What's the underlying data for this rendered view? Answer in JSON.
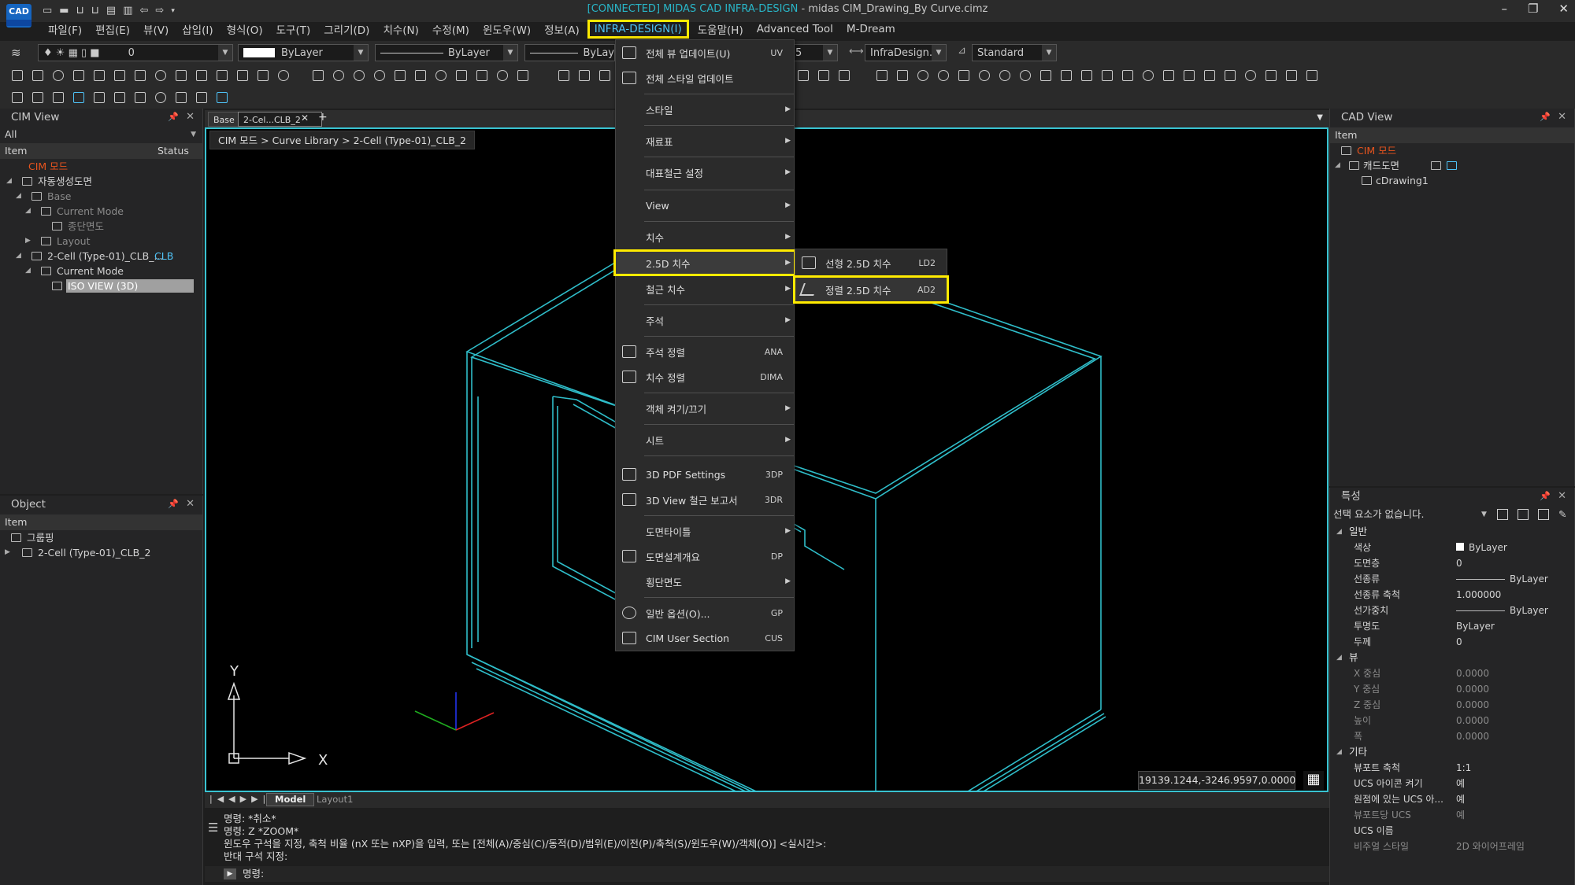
{
  "window": {
    "title_prefix": "[CONNECTED] MIDAS CAD INFRA-DESIGN",
    "title_suffix": " - midas CIM_Drawing_By Curve.cimz",
    "logo": "CAD"
  },
  "menubar": [
    "파일(F)",
    "편집(E)",
    "뷰(V)",
    "삽입(I)",
    "형식(O)",
    "도구(T)",
    "그리기(D)",
    "치수(N)",
    "수정(M)",
    "윈도우(W)",
    "정보(A)",
    "INFRA-DESIGN(I)",
    "도움말(H)",
    "Advanced Tool",
    "M-Dream"
  ],
  "toolbar": {
    "layer_value": "0",
    "color_value": "ByLayer",
    "linetype_value": "ByLayer",
    "lineweight_value": "ByLay",
    "dimstyle_partial": "5",
    "dimstyle_value": "InfraDesign...",
    "textstyle_value": "Standard"
  },
  "cim_view": {
    "title": "CIM View",
    "filter": "All",
    "col_item": "Item",
    "col_status": "Status",
    "tree": [
      {
        "label": "CIM 모드"
      },
      {
        "label": "자동생성도면"
      },
      {
        "label": "Base"
      },
      {
        "label": "Current Mode"
      },
      {
        "label": "종단면도"
      },
      {
        "label": "Layout"
      },
      {
        "label": "2-Cell (Type-01)_CLB_...",
        "status": "CLB"
      },
      {
        "label": "Current Mode"
      },
      {
        "label": "ISO VIEW (3D)"
      }
    ]
  },
  "object_panel": {
    "title": "Object",
    "col_item": "Item",
    "tree": [
      {
        "label": "그룹핑"
      },
      {
        "label": "2-Cell (Type-01)_CLB_2"
      }
    ]
  },
  "doc_tabs": [
    "Base",
    "2-Cel...CLB_2"
  ],
  "breadcrumb": "CIM 모드 > Curve Library > 2-Cell (Type-01)_CLB_2",
  "infra_menu": {
    "items": [
      {
        "label": "전체 뷰 업데이트(U)",
        "shortcut": "UV"
      },
      {
        "label": "전체 스타일 업데이트",
        "shortcut": ""
      },
      {
        "label": "스타일"
      },
      {
        "label": "재료표"
      },
      {
        "label": "대표철근 설정"
      },
      {
        "label": "View"
      },
      {
        "label": "치수"
      },
      {
        "label": "2.5D 치수"
      },
      {
        "label": "철근 치수"
      },
      {
        "label": "주석"
      },
      {
        "label": "주석 정렬",
        "shortcut": "ANA"
      },
      {
        "label": "치수 정렬",
        "shortcut": "DIMA"
      },
      {
        "label": "객체 켜기/끄기"
      },
      {
        "label": "시트"
      },
      {
        "label": "3D PDF Settings",
        "shortcut": "3DP"
      },
      {
        "label": "3D View 철근 보고서",
        "shortcut": "3DR"
      },
      {
        "label": "도면타이틀"
      },
      {
        "label": "도면설계개요",
        "shortcut": "DP"
      },
      {
        "label": "횡단면도"
      },
      {
        "label": "일반 옵션(O)...",
        "shortcut": "GP"
      },
      {
        "label": "CIM User Section",
        "shortcut": "CUS"
      }
    ]
  },
  "submenu_25d": [
    {
      "label": "선형 2.5D 치수",
      "shortcut": "LD2"
    },
    {
      "label": "정렬 2.5D 치수",
      "shortcut": "AD2"
    }
  ],
  "layout_tabs": [
    "Model",
    "Layout1"
  ],
  "command_lines": [
    "명령: *취소*",
    "명령: Z *ZOOM*",
    "윈도우 구석을 지정, 축척 비율 (nX 또는 nXP)을 입력, 또는 [전체(A)/중심(C)/동적(D)/범위(E)/이전(P)/축척(S)/윈도우(W)/객체(O)] <실시간>:",
    "반대 구석 지정:"
  ],
  "command_prompt": "명령:",
  "coordinates": "19139.1244,-3246.9597,0.0000",
  "ucs": {
    "y": "Y",
    "x": "X"
  },
  "cad_view": {
    "title": "CAD View",
    "col_item": "Item",
    "tree": [
      {
        "label": "CIM 모드"
      },
      {
        "label": "캐드도면"
      },
      {
        "label": "cDrawing1"
      }
    ]
  },
  "properties": {
    "title": "특성",
    "selection": "선택 요소가 없습니다.",
    "sections": [
      {
        "name": "일반",
        "rows": [
          {
            "k": "색상",
            "v": "ByLayer"
          },
          {
            "k": "도면층",
            "v": "0"
          },
          {
            "k": "선종류",
            "v": "ByLayer"
          },
          {
            "k": "선종류 축척",
            "v": "1.000000"
          },
          {
            "k": "선가중치",
            "v": "ByLayer"
          },
          {
            "k": "투명도",
            "v": "ByLayer"
          },
          {
            "k": "두께",
            "v": "0"
          }
        ]
      },
      {
        "name": "뷰",
        "rows": [
          {
            "k": "X 중심",
            "v": "0.0000"
          },
          {
            "k": "Y 중심",
            "v": "0.0000"
          },
          {
            "k": "Z 중심",
            "v": "0.0000"
          },
          {
            "k": "높이",
            "v": "0.0000"
          },
          {
            "k": "폭",
            "v": "0.0000"
          }
        ]
      },
      {
        "name": "기타",
        "rows": [
          {
            "k": "뷰포트 축척",
            "v": "1:1"
          },
          {
            "k": "UCS 아이콘 켜기",
            "v": "예"
          },
          {
            "k": "원점에 있는 UCS 아...",
            "v": "예"
          },
          {
            "k": "뷰포트당 UCS",
            "v": "예"
          },
          {
            "k": "UCS 이름",
            "v": ""
          },
          {
            "k": "비주얼 스타일",
            "v": "2D 와이어프레임"
          }
        ]
      }
    ]
  },
  "colors": {
    "accent": "#39c3d1",
    "highlight": "#ffeb00",
    "cim_mode": "#e8541e",
    "link": "#4fc3f7"
  }
}
